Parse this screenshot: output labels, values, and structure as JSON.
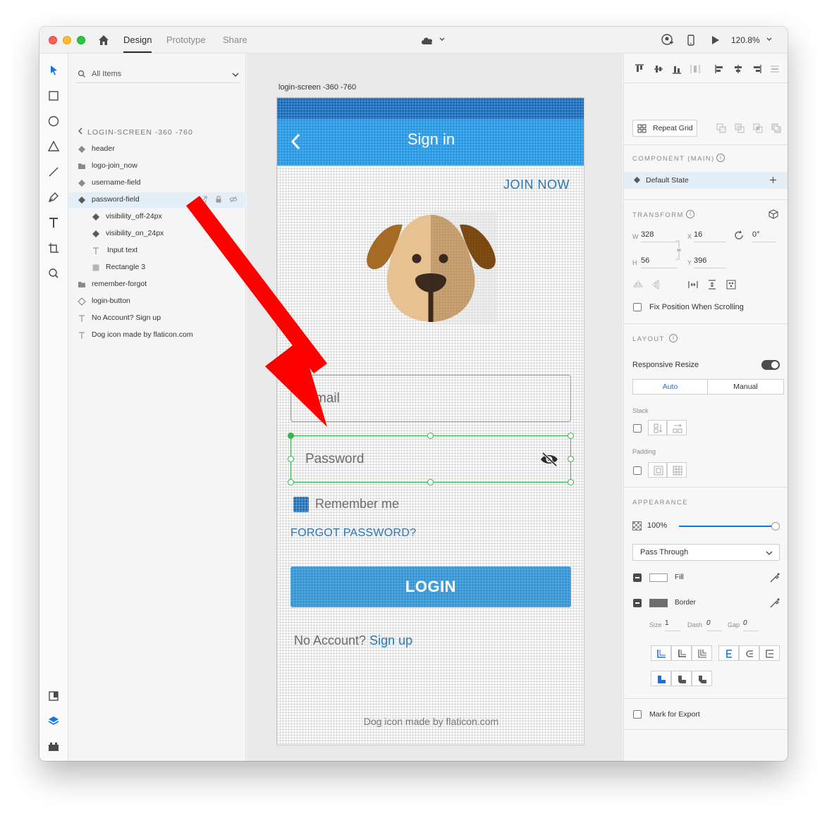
{
  "titlebar": {
    "tabs": [
      {
        "label": "Design",
        "active": true
      },
      {
        "label": "Prototype",
        "active": false
      },
      {
        "label": "Share",
        "active": false
      }
    ],
    "zoom": "120.8%"
  },
  "layers": {
    "search_label": "All Items",
    "breadcrumb": "LOGIN-SCREEN -360 -760",
    "items": [
      {
        "label": "header",
        "icon": "component-icon"
      },
      {
        "label": "logo-join_now",
        "icon": "folder-icon"
      },
      {
        "label": "username-field",
        "icon": "component-icon"
      },
      {
        "label": "password-field",
        "icon": "component-icon",
        "selected": true
      },
      {
        "label": "visibility_off-24px",
        "icon": "component-icon"
      },
      {
        "label": "visibility_on_24px",
        "icon": "component-icon"
      },
      {
        "label": "Input text",
        "icon": "text-icon"
      },
      {
        "label": "Rectangle 3",
        "icon": "rectangle-icon"
      },
      {
        "label": "remember-forgot",
        "icon": "folder-icon"
      },
      {
        "label": "login-button",
        "icon": "component-icon"
      },
      {
        "label": "No Account? Sign up",
        "icon": "text-icon"
      },
      {
        "label": "Dog icon made by flaticon.com",
        "icon": "text-icon"
      }
    ]
  },
  "canvas": {
    "artboard_title": "login-screen -360 -760",
    "app": {
      "header_title": "Sign in",
      "join_now": "JOIN NOW",
      "email_placeholder": "mail",
      "password_placeholder": "Password",
      "remember_label": "Remember me",
      "forgot_label": "FORGOT PASSWORD?",
      "login_label": "LOGIN",
      "signup_prefix": "No Account?",
      "signup_link": "Sign up",
      "credit": "Dog icon made by flaticon.com"
    }
  },
  "props": {
    "repeat_grid": "Repeat Grid",
    "component_heading": "COMPONENT (MAIN)",
    "default_state": "Default State",
    "transform_heading": "TRANSFORM",
    "transform": {
      "w_label": "W",
      "w": "328",
      "x_label": "X",
      "x": "16",
      "h_label": "H",
      "h": "56",
      "y_label": "Y",
      "y": "396",
      "rotation": "0°"
    },
    "fix_position": "Fix Position When Scrolling",
    "layout_heading": "LAYOUT",
    "responsive_resize": "Responsive Resize",
    "resize_modes": [
      "Auto",
      "Manual"
    ],
    "stack_label": "Stack",
    "padding_label": "Padding",
    "appearance_heading": "APPEARANCE",
    "opacity": "100%",
    "opacity_value": 1.0,
    "blend_mode": "Pass Through",
    "fill_label": "Fill",
    "border_label": "Border",
    "border_size_label": "Size",
    "border_size": "1",
    "border_dash_label": "Dash",
    "border_dash": "0",
    "border_gap_label": "Gap",
    "border_gap": "0",
    "mark_export": "Mark for Export"
  },
  "colors": {
    "accent": "#1473e6",
    "app_blue": "#2f97dc",
    "link_blue": "#2a77b8",
    "selection_green": "#37b24d",
    "annotation_red": "#ff0000"
  }
}
